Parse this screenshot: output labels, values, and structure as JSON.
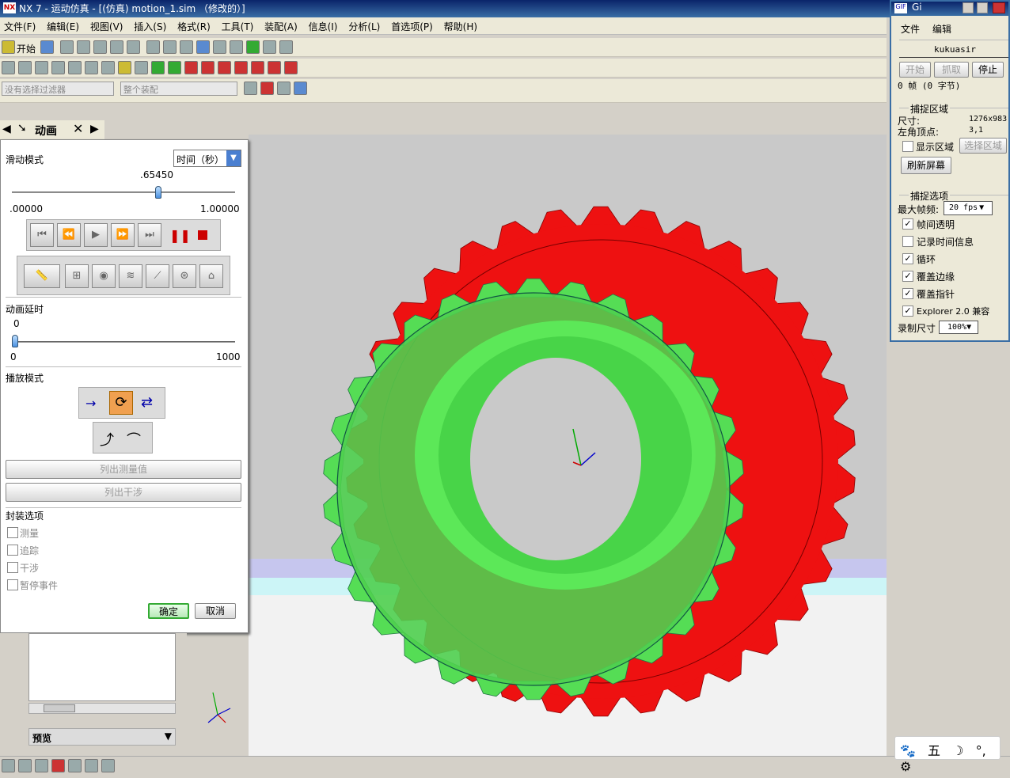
{
  "window": {
    "title": "NX 7 - 运动仿真 - [(仿真) motion_1.sim （修改的）]",
    "logo": "NX"
  },
  "menu": [
    "文件(F)",
    "编辑(E)",
    "视图(V)",
    "插入(S)",
    "格式(R)",
    "工具(T)",
    "装配(A)",
    "信息(I)",
    "分析(L)",
    "首选项(P)",
    "帮助(H)"
  ],
  "toolbar": {
    "start_label": "开始",
    "filter_placeholder": "没有选择过滤器",
    "assembly_scope": "整个装配"
  },
  "panel_tabs": {
    "title": "动画"
  },
  "dialog": {
    "slide_mode_label": "滑动模式",
    "slide_mode_value": "时间（秒）",
    "slider_value": ".65450",
    "slider_value_fraction": 0.6545,
    "slider_min": ".00000",
    "slider_max": "1.00000",
    "delay_label": "动画延时",
    "delay_value": "0",
    "delay_min": "0",
    "delay_max": "1000",
    "play_mode_label": "播放模式",
    "list_measure": "列出测量值",
    "list_interference": "列出干涉",
    "package_label": "封装选项",
    "package_options": [
      "测量",
      "追踪",
      "干涉",
      "暂停事件"
    ],
    "ok": "确定",
    "cancel": "取消"
  },
  "lower_panel": {
    "preview_label": "预览"
  },
  "gif_recorder": {
    "title": "Gi",
    "menu": [
      "文件",
      "编辑"
    ],
    "user": "kukuasir",
    "buttons": {
      "start": "开始",
      "capture": "抓取",
      "stop": "停止"
    },
    "frames": "0 帧 (0 字节)",
    "capture_region_label": "捕捉区域",
    "size_label": "尺寸:",
    "size_value": "1276x983",
    "origin_label": "左角顶点:",
    "origin_value": "3,1",
    "show_region": "显示区域",
    "select_region": "选择区域",
    "refresh": "刷新屏幕",
    "capture_options_label": "捕捉选项",
    "max_fps_label": "最大帧频:",
    "max_fps_value": "20 fps",
    "options": [
      "帧间透明",
      "记录时间信息",
      "循环",
      "覆盖边缘",
      "覆盖指针",
      "Explorer 2.0 兼容"
    ],
    "options_checked": [
      true,
      false,
      true,
      true,
      true,
      true
    ],
    "record_size_label": "录制尺寸",
    "record_size_value": "100%"
  },
  "ime": {
    "items": [
      "🐾",
      "五",
      "☽",
      "°,",
      "⚙"
    ]
  },
  "colors": {
    "gear_red": "#ee1111",
    "gear_green": "#55dd55",
    "viewport": "#c9c9c9"
  }
}
